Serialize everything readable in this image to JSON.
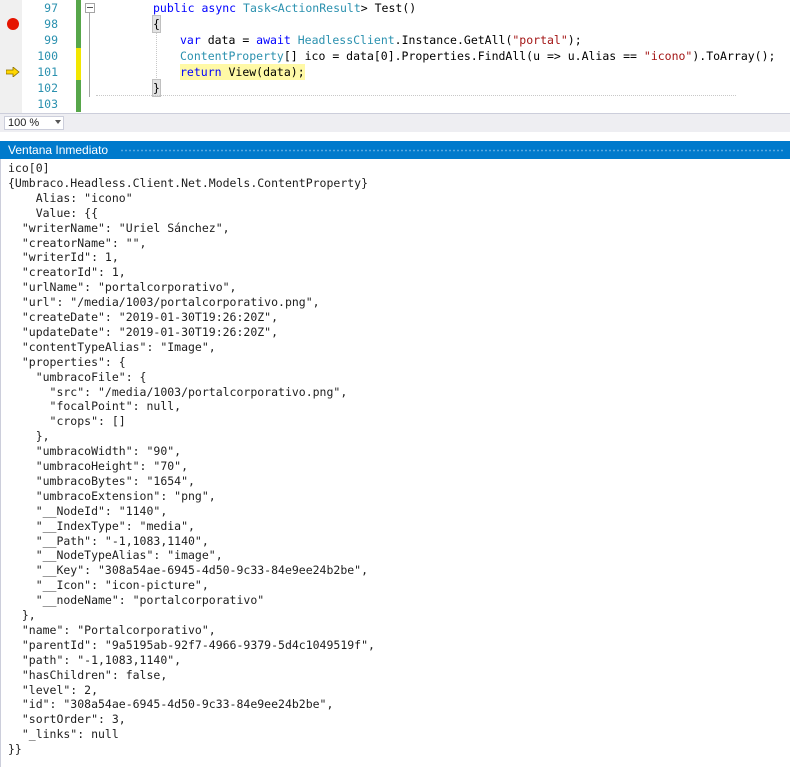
{
  "editor": {
    "lines": [
      {
        "num": "97"
      },
      {
        "num": "98"
      },
      {
        "num": "99"
      },
      {
        "num": "100"
      },
      {
        "num": "101"
      },
      {
        "num": "102"
      },
      {
        "num": "103"
      }
    ],
    "code": {
      "l97_kw1": "public",
      "l97_kw2": "async",
      "l97_ty1": "Task",
      "l97_p1": "<",
      "l97_ty2": "ActionResult",
      "l97_p2": "> Test()",
      "l98_brace": "{",
      "l99_kw1": "var",
      "l99_p1": " data = ",
      "l99_kw2": "await",
      "l99_ty1": "HeadlessClient",
      "l99_p2": ".Instance.GetAll(",
      "l99_st1": "\"portal\"",
      "l99_p3": ");",
      "l100_ty1": "ContentProperty",
      "l100_p1": "[] ico = data[0].Properties.FindAll(u => u.Alias == ",
      "l100_st1": "\"icono\"",
      "l100_p2": ").ToArray();",
      "l101_kw1": "return",
      "l101_p1": " View(data);",
      "l102_brace": "}"
    },
    "markers": {
      "breakpoint_line": "98",
      "current_line": "101"
    },
    "colors": {
      "breakpoint": "#e51400",
      "current_arrow": "#ffd700",
      "change_saved": "#57a64a",
      "change_unsaved": "#f2e600",
      "line_number": "#2b91af"
    }
  },
  "zoom": {
    "value": "100 %"
  },
  "immediate_window": {
    "title": "Ventana Inmediato",
    "lines": [
      "ico[0]",
      "{Umbraco.Headless.Client.Net.Models.ContentProperty}",
      "    Alias: \"icono\"",
      "    Value: {{",
      "  \"writerName\": \"Uriel Sánchez\",",
      "  \"creatorName\": \"\",",
      "  \"writerId\": 1,",
      "  \"creatorId\": 1,",
      "  \"urlName\": \"portalcorporativo\",",
      "  \"url\": \"/media/1003/portalcorporativo.png\",",
      "  \"createDate\": \"2019-01-30T19:26:20Z\",",
      "  \"updateDate\": \"2019-01-30T19:26:20Z\",",
      "  \"contentTypeAlias\": \"Image\",",
      "  \"properties\": {",
      "    \"umbracoFile\": {",
      "      \"src\": \"/media/1003/portalcorporativo.png\",",
      "      \"focalPoint\": null,",
      "      \"crops\": []",
      "    },",
      "    \"umbracoWidth\": \"90\",",
      "    \"umbracoHeight\": \"70\",",
      "    \"umbracoBytes\": \"1654\",",
      "    \"umbracoExtension\": \"png\",",
      "    \"__NodeId\": \"1140\",",
      "    \"__IndexType\": \"media\",",
      "    \"__Path\": \"-1,1083,1140\",",
      "    \"__NodeTypeAlias\": \"image\",",
      "    \"__Key\": \"308a54ae-6945-4d50-9c33-84e9ee24b2be\",",
      "    \"__Icon\": \"icon-picture\",",
      "    \"__nodeName\": \"portalcorporativo\"",
      "  },",
      "  \"name\": \"Portalcorporativo\",",
      "  \"parentId\": \"9a5195ab-92f7-4966-9379-5d4c1049519f\",",
      "  \"path\": \"-1,1083,1140\",",
      "  \"hasChildren\": false,",
      "  \"level\": 2,",
      "  \"id\": \"308a54ae-6945-4d50-9c33-84e9ee24b2be\",",
      "  \"sortOrder\": 3,",
      "  \"_links\": null",
      "}}"
    ]
  }
}
